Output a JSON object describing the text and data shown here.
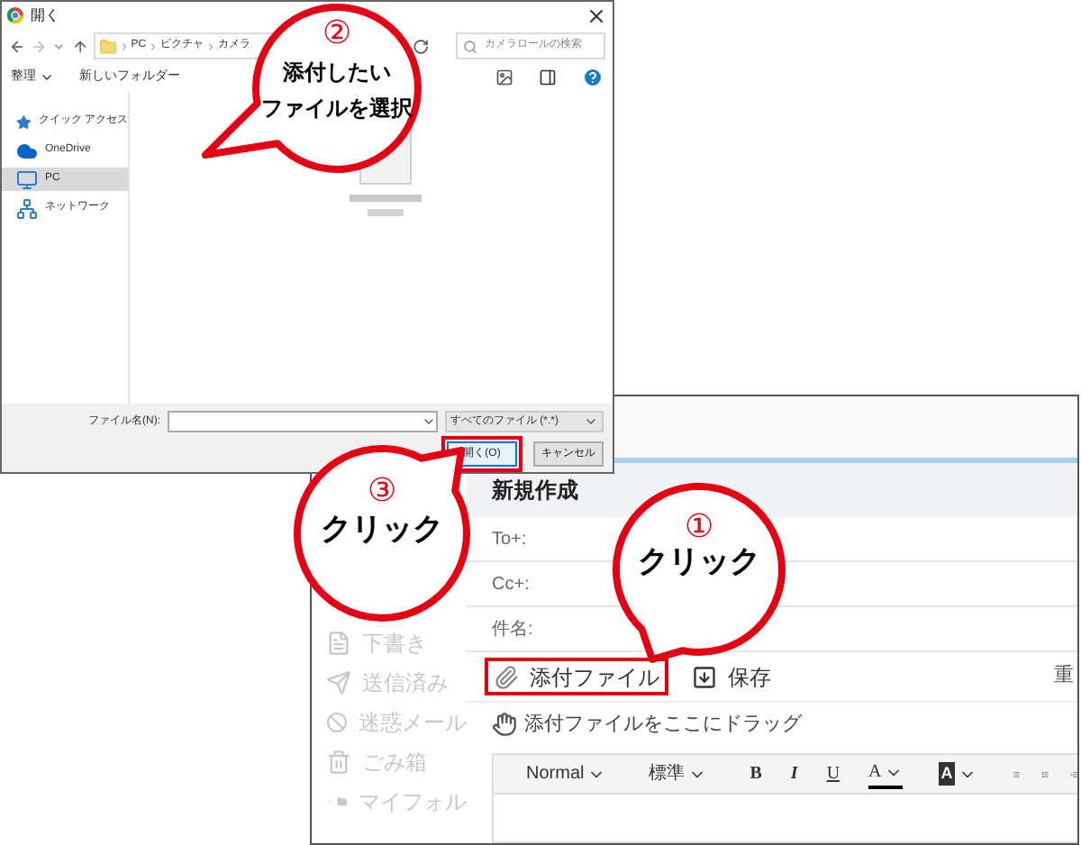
{
  "dialog": {
    "title": "開く",
    "breadcrumb": [
      "PC",
      "ピクチャ",
      "カメラ"
    ],
    "search": {
      "placeholder": "カメラロールの検索"
    },
    "organize": "整理",
    "new_folder": "新しいフォルダー",
    "nav_items": [
      {
        "label": "クイック アクセス",
        "kind": "star",
        "selected": false
      },
      {
        "label": "OneDrive",
        "kind": "cloud",
        "selected": false
      },
      {
        "label": "PC",
        "kind": "pc",
        "selected": true
      },
      {
        "label": "ネットワーク",
        "kind": "network",
        "selected": false
      }
    ],
    "filename_label": "ファイル名(N):",
    "filter": "すべてのファイル (*.*)",
    "buttons": [
      {
        "label": "開く(O)",
        "highlighted": true
      },
      {
        "label": "キャンセル",
        "highlighted": false
      }
    ]
  },
  "mail": {
    "title": "新規作成",
    "folders": [
      {
        "label": "下書き",
        "kind": "draft"
      },
      {
        "label": "送信済み",
        "kind": "sent"
      },
      {
        "label": "迷惑メール",
        "kind": "spam"
      },
      {
        "label": "ごみ箱",
        "kind": "trash"
      },
      {
        "label": "マイフォル",
        "kind": "folder"
      }
    ],
    "fields": [
      "To+:",
      "Cc+:",
      "件名:"
    ],
    "actions": [
      {
        "label": "添付ファイル",
        "kind": "attach",
        "highlighted": true
      },
      {
        "label": "保存",
        "kind": "save",
        "highlighted": false
      }
    ],
    "right_cut": "重",
    "drop_hint": "添付ファイルをここにドラッグ",
    "editor_tools": [
      {
        "kind": "dropdown",
        "label": "Normal"
      },
      {
        "kind": "dropdown",
        "label": "標準"
      },
      {
        "kind": "bold",
        "label": "B"
      },
      {
        "kind": "italic",
        "label": "I"
      },
      {
        "kind": "underline",
        "label": "U"
      },
      {
        "kind": "color",
        "label": "A"
      },
      {
        "kind": "highlight",
        "label": "A"
      },
      {
        "kind": "bullets"
      },
      {
        "kind": "numbers"
      },
      {
        "kind": "indent"
      }
    ]
  },
  "callouts": [
    {
      "number": "②",
      "lines": [
        "添付したい",
        "ファイルを選択"
      ]
    },
    {
      "number": "③",
      "lines": [
        "クリック"
      ]
    },
    {
      "number": "①",
      "lines": [
        "クリック"
      ]
    }
  ]
}
